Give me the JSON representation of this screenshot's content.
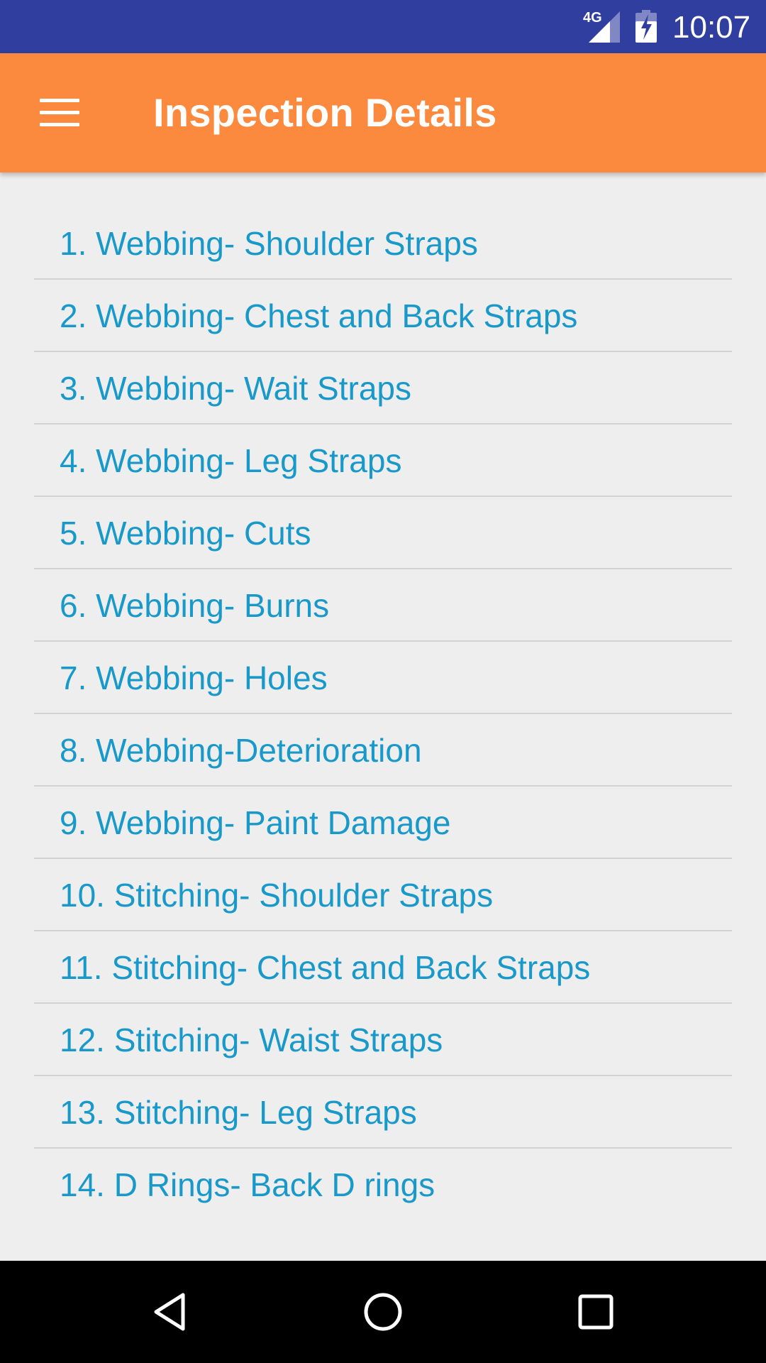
{
  "status_bar": {
    "network": "4G",
    "time": "10:07",
    "icons": [
      "signal-icon",
      "battery-charging-icon"
    ]
  },
  "app_bar": {
    "title": "Inspection Details",
    "menu_icon": "hamburger-menu-icon"
  },
  "inspection_items": [
    "1. Webbing- Shoulder Straps",
    "2. Webbing- Chest and Back Straps",
    "3. Webbing- Wait Straps",
    "4. Webbing- Leg Straps",
    "5. Webbing- Cuts",
    "6. Webbing- Burns",
    "7. Webbing- Holes",
    "8. Webbing-Deterioration",
    "9. Webbing- Paint Damage",
    "10. Stitching- Shoulder Straps",
    "11. Stitching- Chest and Back Straps",
    "12. Stitching- Waist Straps",
    "13. Stitching- Leg Straps",
    "14. D Rings- Back D rings"
  ],
  "nav_bar": {
    "icons": [
      "back-icon",
      "home-icon",
      "recents-icon"
    ]
  },
  "colors": {
    "status_bar": "#303f9f",
    "app_bar": "#fb8a3e",
    "background": "#eeeeee",
    "item_text": "#1899c9",
    "divider": "#d2d2d2"
  }
}
